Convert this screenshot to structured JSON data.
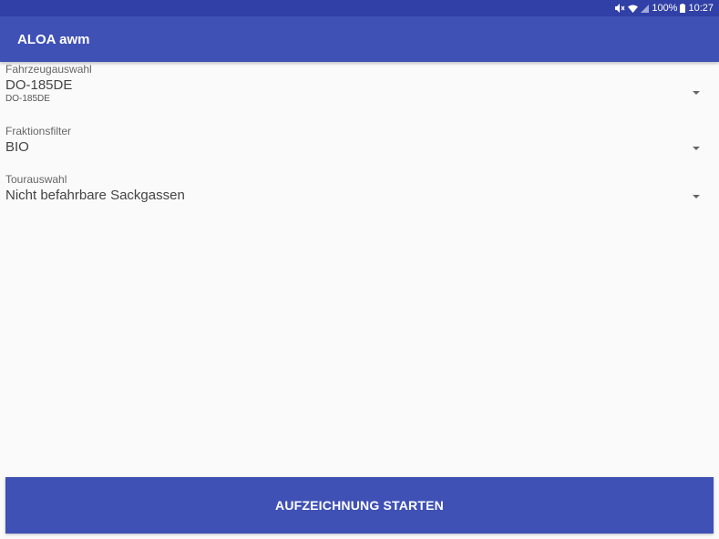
{
  "status_bar": {
    "icons": [
      "mute-icon",
      "wifi-icon",
      "signal-icon",
      "battery-icon"
    ],
    "battery": "100%",
    "time": "10:27"
  },
  "app_bar": {
    "title": "ALOA awm"
  },
  "vehicle": {
    "label": "Fahrzeugauswahl",
    "value": "DO-185DE",
    "sub": "DO-185DE"
  },
  "fraction": {
    "label": "Fraktionsfilter",
    "value": "BIO"
  },
  "tour": {
    "label": "Tourauswahl",
    "value": "Nicht befahrbare Sackgassen"
  },
  "start_button": {
    "label": "AUFZEICHNUNG STARTEN"
  },
  "colors": {
    "status_bar": "#3140a6",
    "primary": "#3f51b5",
    "background": "#fafafa"
  }
}
